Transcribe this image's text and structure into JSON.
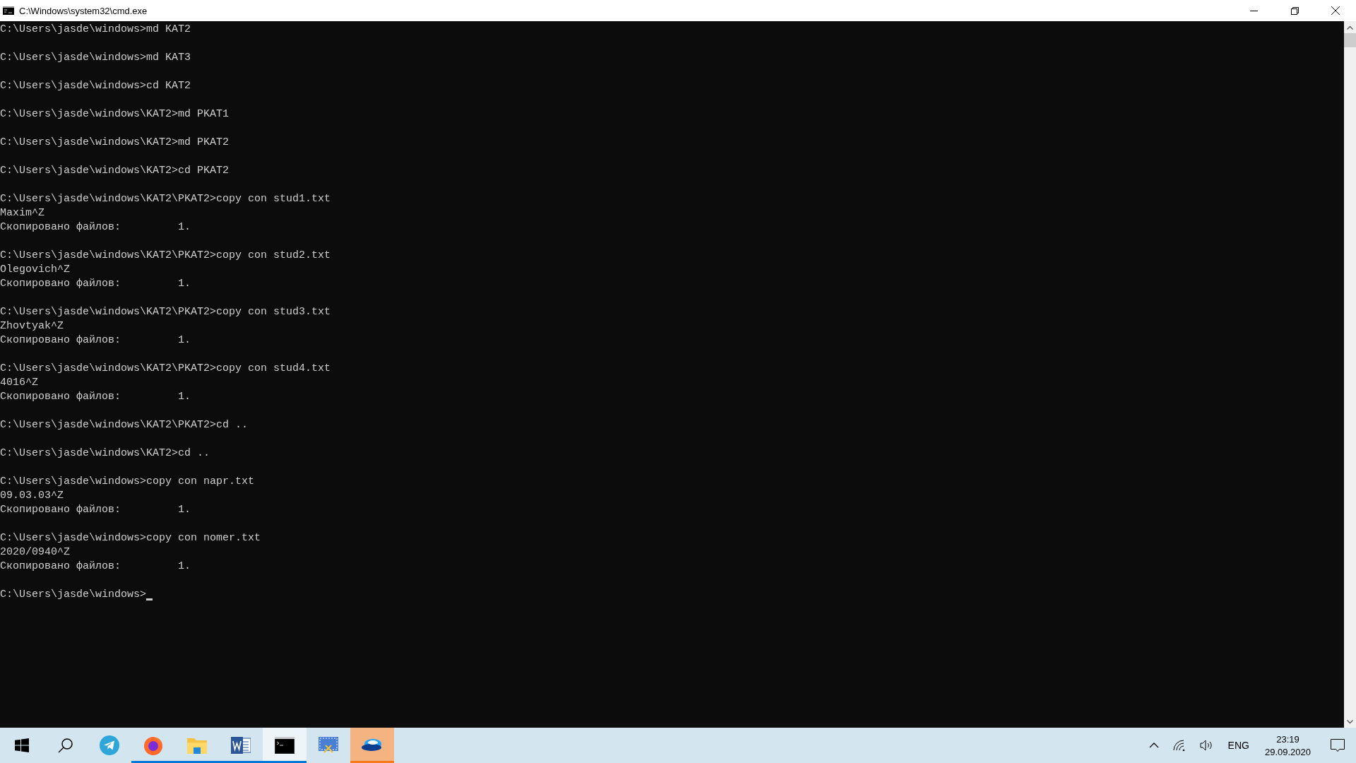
{
  "window": {
    "title": "C:\\Windows\\system32\\cmd.exe"
  },
  "console": {
    "cursor": true,
    "blocks": [
      [
        "C:\\Users\\jasde\\windows>md KAT2"
      ],
      [
        "C:\\Users\\jasde\\windows>md KAT3"
      ],
      [
        "C:\\Users\\jasde\\windows>cd KAT2"
      ],
      [
        "C:\\Users\\jasde\\windows\\KAT2>md PKAT1"
      ],
      [
        "C:\\Users\\jasde\\windows\\KAT2>md PKAT2"
      ],
      [
        "C:\\Users\\jasde\\windows\\KAT2>cd PKAT2"
      ],
      [
        "C:\\Users\\jasde\\windows\\KAT2\\PKAT2>copy con stud1.txt",
        "Maxim^Z",
        "Скопировано файлов:         1."
      ],
      [
        "C:\\Users\\jasde\\windows\\KAT2\\PKAT2>copy con stud2.txt",
        "Olegovich^Z",
        "Скопировано файлов:         1."
      ],
      [
        "C:\\Users\\jasde\\windows\\KAT2\\PKAT2>copy con stud3.txt",
        "Zhovtyak^Z",
        "Скопировано файлов:         1."
      ],
      [
        "C:\\Users\\jasde\\windows\\KAT2\\PKAT2>copy con stud4.txt",
        "4016^Z",
        "Скопировано файлов:         1."
      ],
      [
        "C:\\Users\\jasde\\windows\\KAT2\\PKAT2>cd .."
      ],
      [
        "C:\\Users\\jasde\\windows\\KAT2>cd .."
      ],
      [
        "C:\\Users\\jasde\\windows>copy con napr.txt",
        "09.03.03^Z",
        "Скопировано файлов:         1."
      ],
      [
        "C:\\Users\\jasde\\windows>copy con nomer.txt",
        "2020/0940^Z",
        "Скопировано файлов:         1."
      ],
      [
        "C:\\Users\\jasde\\windows>"
      ]
    ]
  },
  "taskbar": {
    "apps": [
      {
        "kind": "start",
        "running": false,
        "selected": false,
        "flashing": false
      },
      {
        "kind": "search",
        "running": false,
        "selected": false,
        "flashing": false
      },
      {
        "kind": "telegram",
        "running": false,
        "selected": false,
        "flashing": false
      },
      {
        "kind": "firefox",
        "running": true,
        "selected": false,
        "flashing": false
      },
      {
        "kind": "explorer",
        "running": true,
        "selected": false,
        "flashing": false
      },
      {
        "kind": "word",
        "running": true,
        "selected": false,
        "flashing": false
      },
      {
        "kind": "terminal",
        "running": true,
        "selected": true,
        "flashing": false
      },
      {
        "kind": "snipping",
        "running": false,
        "selected": false,
        "flashing": false
      },
      {
        "kind": "disk",
        "running": true,
        "selected": false,
        "flashing": true
      }
    ],
    "tray": {
      "language": "ENG",
      "time": "23:19",
      "date": "29.09.2020"
    }
  }
}
